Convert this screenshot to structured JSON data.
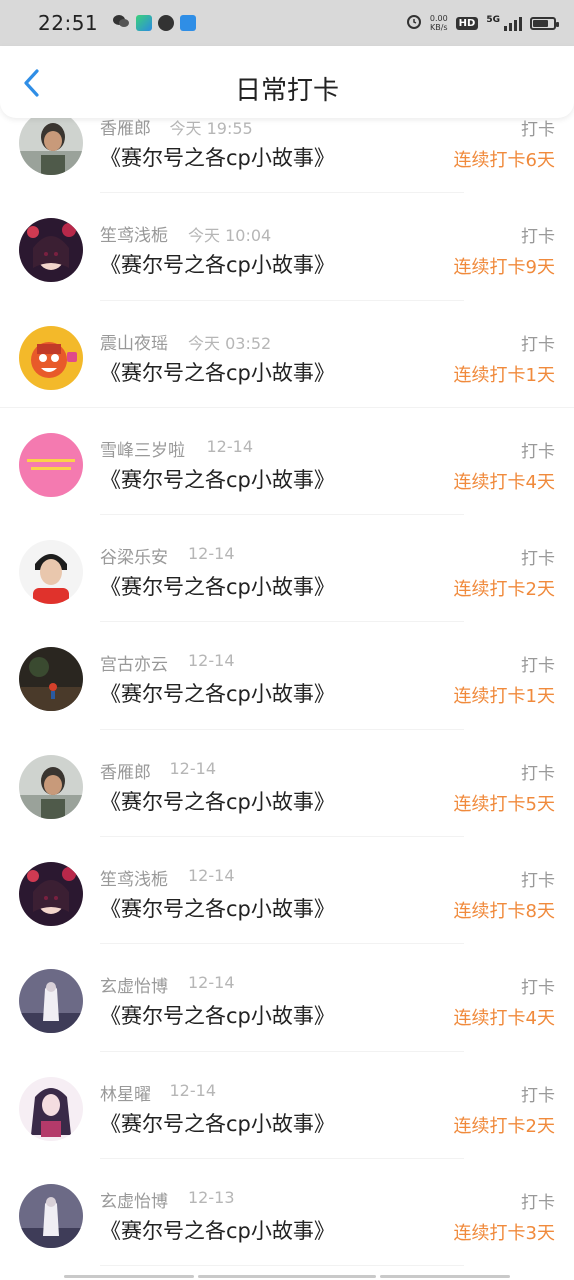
{
  "status_bar": {
    "time": "22:51",
    "net_speed_value": "0.00",
    "net_speed_unit": "KB/s",
    "hd_label": "HD",
    "network": "5G",
    "battery_level": 0.75
  },
  "header": {
    "title": "日常打卡",
    "back_icon": "chevron-left-icon"
  },
  "colors": {
    "accent_blue": "#2f8ee6",
    "streak_orange": "#f08a3c",
    "muted_gray": "#999999"
  },
  "checkins": [
    {
      "name": "香雁郎",
      "time": "今天 19:55",
      "book": "《赛尔号之各cp小故事》",
      "tag": "打卡",
      "streak": "连续打卡6天"
    },
    {
      "name": "笙鸢浅栀",
      "time": "今天 10:04",
      "book": "《赛尔号之各cp小故事》",
      "tag": "打卡",
      "streak": "连续打卡9天"
    },
    {
      "name": "震山夜瑶",
      "time": "今天 03:52",
      "book": "《赛尔号之各cp小故事》",
      "tag": "打卡",
      "streak": "连续打卡1天"
    },
    {
      "name": "雪峰三岁啦",
      "time": "12-14",
      "book": "《赛尔号之各cp小故事》",
      "tag": "打卡",
      "streak": "连续打卡4天"
    },
    {
      "name": "谷梁乐安",
      "time": "12-14",
      "book": "《赛尔号之各cp小故事》",
      "tag": "打卡",
      "streak": "连续打卡2天"
    },
    {
      "name": "宫古亦云",
      "time": "12-14",
      "book": "《赛尔号之各cp小故事》",
      "tag": "打卡",
      "streak": "连续打卡1天"
    },
    {
      "name": "香雁郎",
      "time": "12-14",
      "book": "《赛尔号之各cp小故事》",
      "tag": "打卡",
      "streak": "连续打卡5天"
    },
    {
      "name": "笙鸢浅栀",
      "time": "12-14",
      "book": "《赛尔号之各cp小故事》",
      "tag": "打卡",
      "streak": "连续打卡8天"
    },
    {
      "name": "玄虚怡博",
      "time": "12-14",
      "book": "《赛尔号之各cp小故事》",
      "tag": "打卡",
      "streak": "连续打卡4天"
    },
    {
      "name": "林星曜",
      "time": "12-14",
      "book": "《赛尔号之各cp小故事》",
      "tag": "打卡",
      "streak": "连续打卡2天"
    },
    {
      "name": "玄虚怡博",
      "time": "12-13",
      "book": "《赛尔号之各cp小故事》",
      "tag": "打卡",
      "streak": "连续打卡3天"
    }
  ]
}
